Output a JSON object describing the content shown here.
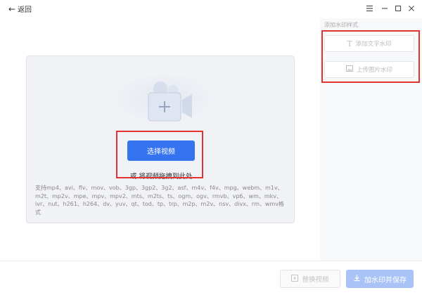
{
  "titlebar": {
    "back_label": "返回",
    "controls": [
      "menu-icon",
      "minimize-icon",
      "maximize-icon",
      "close-icon"
    ]
  },
  "main": {
    "choose_button_label": "选择视频",
    "drag_hint": "或 将视频拖拽到此处",
    "supported_formats": "支持mp4、avi、flv、mov、vob、3gp、3gp2、3g2、asf、m4v、f4v、mpg、webm、m1v、m2t、mp2v、mpe、mpv、mpv2、mts、m2ts、ts、ogm、ogv、rmvb、vp6、wm、mkv、ivr、nut、h261、h264、dv、yuv、qt、tod、tp、trp、m2p、m2v、nsv、divx、rm、wmv格式"
  },
  "side": {
    "title": "添加水印样式",
    "add_text_label": "添加文字水印",
    "upload_image_label": "上传图片水印"
  },
  "bottom": {
    "replace_label": "替换视频",
    "save_label": "加水印并保存"
  },
  "colors": {
    "primary": "#3574f0",
    "primary_disabled": "#aac3f6",
    "highlight": "#e23232"
  }
}
